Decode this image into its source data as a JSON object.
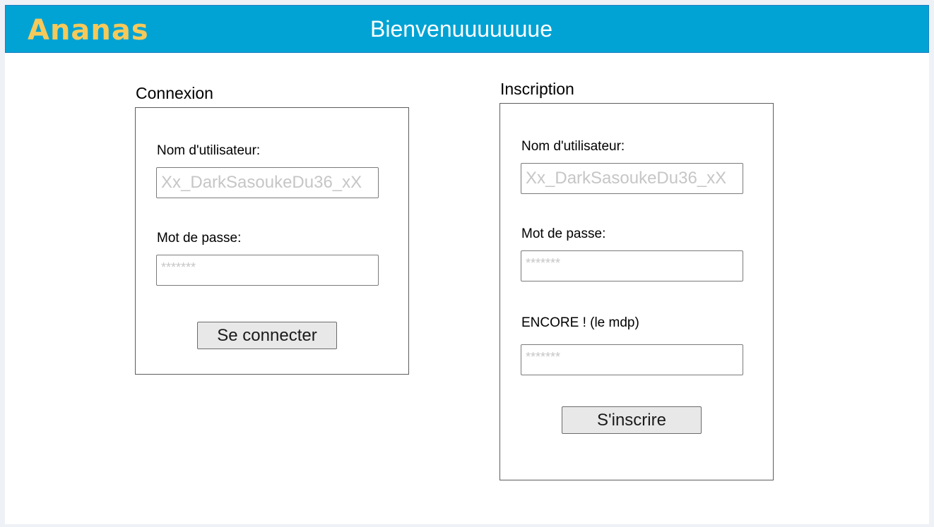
{
  "header": {
    "logo": "Ananas",
    "title": "Bienvenuuuuuuue"
  },
  "login": {
    "title": "Connexion",
    "username_label": "Nom d'utilisateur:",
    "username_placeholder": "Xx_DarkSasoukeDu36_xX",
    "password_label": "Mot de passe:",
    "password_placeholder": "*******",
    "submit_label": "Se connecter"
  },
  "signup": {
    "title": "Inscription",
    "username_label": "Nom d'utilisateur:",
    "username_placeholder": "Xx_DarkSasoukeDu36_xX",
    "password_label": "Mot de passe:",
    "password_placeholder": "*******",
    "confirm_label": "ENCORE ! (le mdp)",
    "confirm_placeholder": "*******",
    "submit_label": "S'inscrire"
  },
  "colors": {
    "header_background": "#00a3d4",
    "logo": "#f5c95a",
    "page_background": "#eef1f6"
  }
}
